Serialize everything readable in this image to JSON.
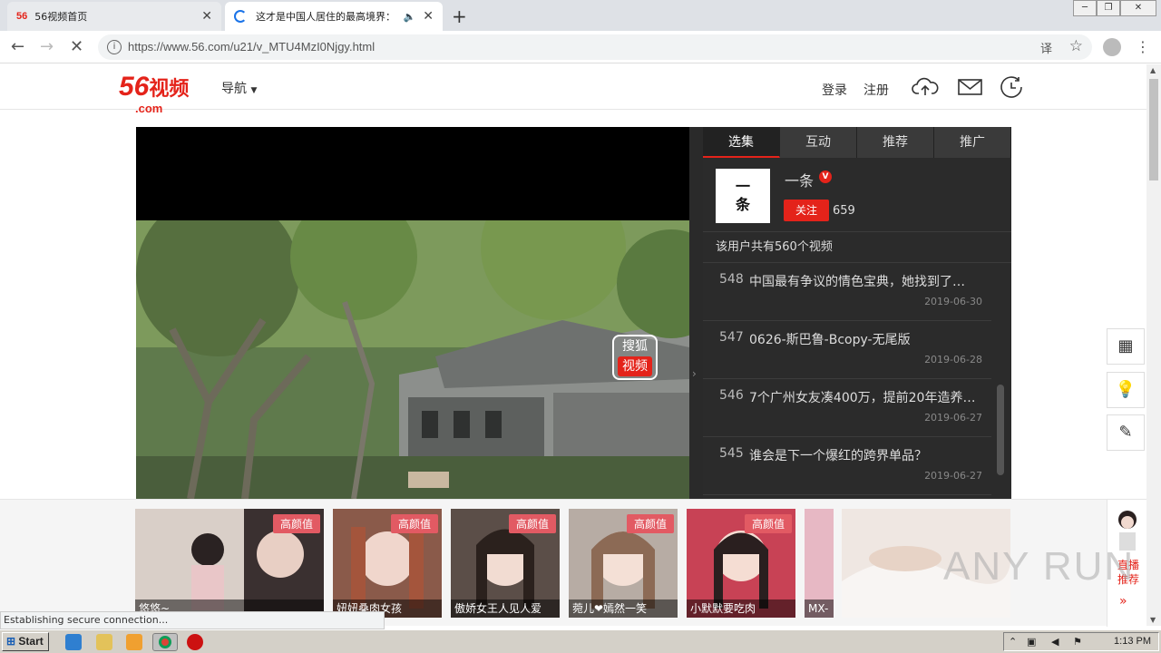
{
  "browser": {
    "tabs": [
      {
        "favicon": "56",
        "title": "56视频首页",
        "active": false
      },
      {
        "title": "这才是中国人居住的最高境界：",
        "active": true
      }
    ],
    "url": "https://www.56.com/u21/v_MTU4MzI0Njgy.html",
    "status_message": "Establishing secure connection..."
  },
  "site": {
    "logo_main": "56",
    "logo_cn": "视频",
    "logo_suffix": ".com",
    "nav_label": "导航",
    "login": "登录",
    "register": "注册"
  },
  "panel": {
    "tabs": [
      "选集",
      "互动",
      "推荐",
      "推广"
    ],
    "author": {
      "avatar_text_1": "一",
      "avatar_text_2": "条",
      "name": "一条",
      "verified_mark": "V",
      "follow_label": "关注",
      "followers": "659"
    },
    "video_count": "该用户共有560个视频",
    "videos": [
      {
        "num": "548",
        "title": "中国最有争议的情色宝典，她找到了最...",
        "date": "2019-06-30"
      },
      {
        "num": "547",
        "title": "0626-斯巴鲁-Bcopy-无尾版",
        "date": "2019-06-28"
      },
      {
        "num": "546",
        "title": "7个广州女友凑400万，提前20年造养老...",
        "date": "2019-06-27"
      },
      {
        "num": "545",
        "title": "谁会是下一个爆红的跨界单品？",
        "date": "2019-06-27"
      }
    ]
  },
  "player": {
    "badge_line1": "搜狐",
    "badge_line2": "视频"
  },
  "recommend": {
    "cards": [
      {
        "tag": "高颜值",
        "caption": "悠悠~"
      },
      {
        "tag": "高颜值",
        "caption": "妞妞桑肉女孩"
      },
      {
        "tag": "高颜值",
        "caption": "傲娇女王人见人爱"
      },
      {
        "tag": "高颜值",
        "caption": "菀儿❤嫣然一笑"
      },
      {
        "tag": "高颜值",
        "caption": "小默默要吃肉"
      },
      {
        "caption": "MX-"
      }
    ],
    "live_label": "直播推荐",
    "live_arrow": "»"
  },
  "watermark": "ANY RUN",
  "taskbar": {
    "start_label": "Start",
    "clock": "1:13 PM"
  },
  "colors": {
    "brand_red": "#e4231a",
    "panel_bg": "#2b2b2b",
    "tag_pink": "#e25a63"
  }
}
